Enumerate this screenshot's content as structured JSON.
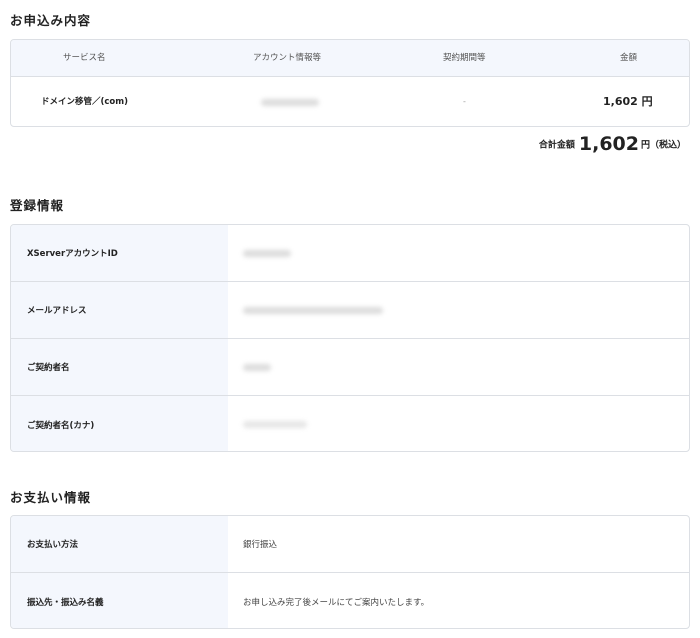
{
  "order": {
    "title": "お申込み内容",
    "headers": [
      "サービス名",
      "アカウント情報等",
      "契約期間等",
      "金額"
    ],
    "row": {
      "service": "ドメイン移管／(com)",
      "period": "-",
      "amount": "1,602 円"
    },
    "total_label": "合計金額",
    "total_value": "1,602",
    "total_unit": "円（税込）"
  },
  "registration": {
    "title": "登録情報",
    "rows": [
      {
        "label": "XServerアカウントID"
      },
      {
        "label": "メールアドレス"
      },
      {
        "label": "ご契約者名"
      },
      {
        "label": "ご契約者名(カナ)"
      }
    ]
  },
  "payment": {
    "title": "お支払い情報",
    "rows": [
      {
        "label": "お支払い方法",
        "value": "銀行振込"
      },
      {
        "label": "振込先・振込み名義",
        "value": "お申し込み完了後メールにてご案内いたします。"
      }
    ]
  }
}
